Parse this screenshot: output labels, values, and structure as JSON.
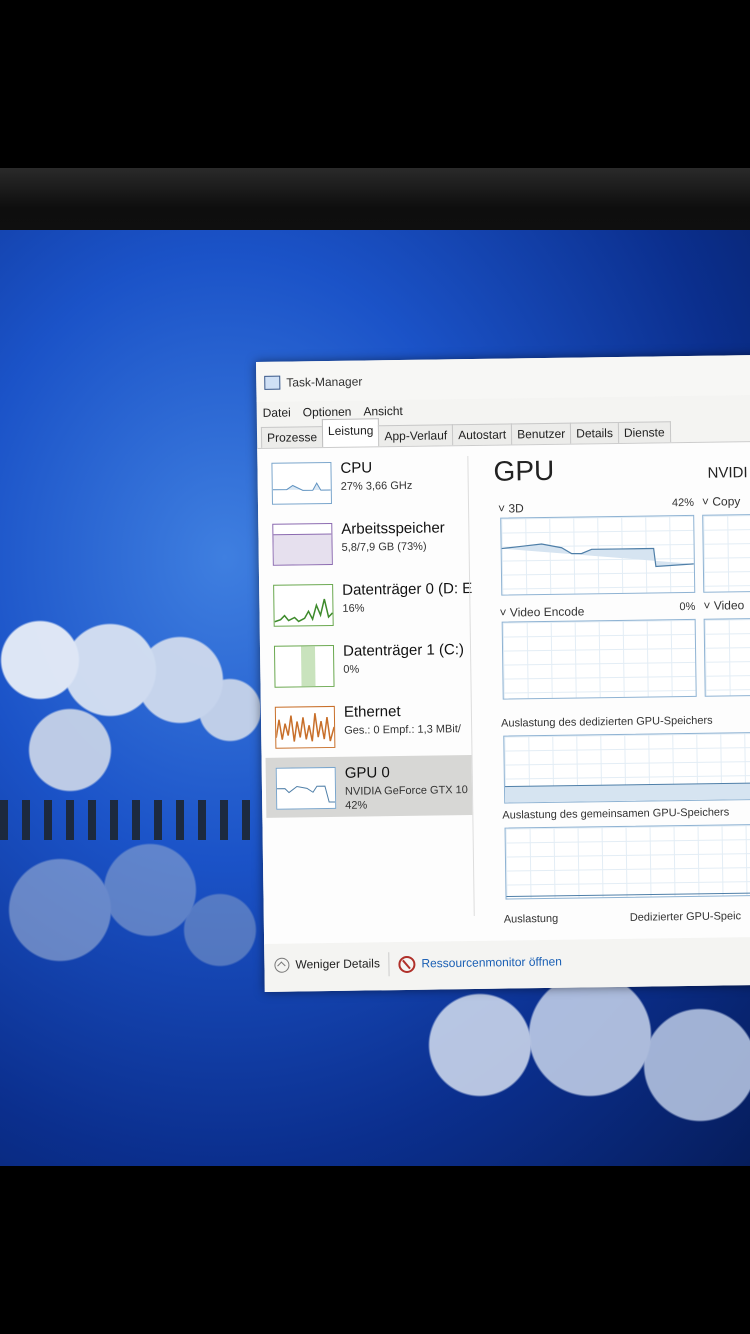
{
  "window": {
    "title": "Task-Manager"
  },
  "menu": {
    "items": [
      "Datei",
      "Optionen",
      "Ansicht"
    ]
  },
  "tabs": [
    "Prozesse",
    "Leistung",
    "App-Verlauf",
    "Autostart",
    "Benutzer",
    "Details",
    "Dienste"
  ],
  "sidebar": {
    "items": [
      {
        "name": "CPU",
        "sub": "27% 3,66 GHz",
        "sub2": ""
      },
      {
        "name": "Arbeitsspeicher",
        "sub": "5,8/7,9 GB (73%)",
        "sub2": ""
      },
      {
        "name": "Datenträger 0 (D: E",
        "sub": "16%",
        "sub2": ""
      },
      {
        "name": "Datenträger 1 (C:)",
        "sub": "0%",
        "sub2": ""
      },
      {
        "name": "Ethernet",
        "sub": "Ges.: 0 Empf.: 1,3 MBit/",
        "sub2": ""
      },
      {
        "name": "GPU 0",
        "sub": "NVIDIA GeForce GTX 10",
        "sub2": "42%"
      }
    ]
  },
  "main": {
    "title": "GPU",
    "model": "NVIDI",
    "engine_3d": {
      "label": "3D",
      "value": "42%"
    },
    "engine_copy": {
      "label": "Copy"
    },
    "engine_video_encode": {
      "label": "Video Encode",
      "value": "0%"
    },
    "engine_video_decode": {
      "label": "Video"
    },
    "dedicated_mem_label": "Auslastung des dedizierten GPU-Speichers",
    "shared_mem_label": "Auslastung des gemeinsamen GPU-Speichers",
    "bottom_label_left": "Auslastung",
    "bottom_label_right": "Dedizierter GPU-Speic"
  },
  "footer": {
    "fewer_details": "Weniger Details",
    "resource_monitor": "Ressourcenmonitor öffnen"
  },
  "colors": {
    "accent": "#1a5fb4",
    "cpu": "#7ba6cc",
    "disk": "#6aa84f",
    "ethernet": "#c86f2a"
  }
}
